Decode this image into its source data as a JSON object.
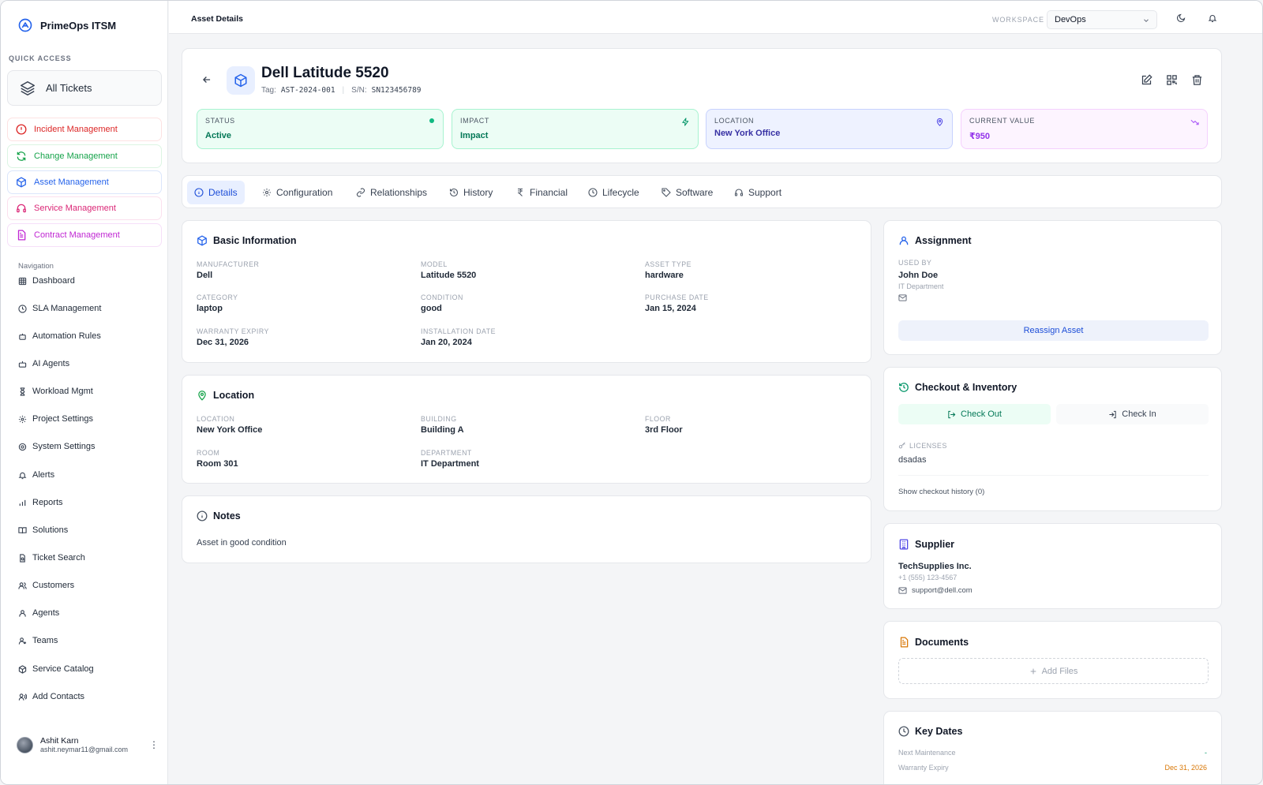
{
  "sidebar": {
    "brand": "PrimeOps ITSM",
    "quick_access_label": "QUICK ACCESS",
    "all_tickets": "All Tickets",
    "modules": [
      {
        "label": "Incident Management",
        "color": "#dc2626"
      },
      {
        "label": "Change Management",
        "color": "#16a34a"
      },
      {
        "label": "Asset Management",
        "color": "#2563eb"
      },
      {
        "label": "Service Management",
        "color": "#db2777"
      },
      {
        "label": "Contract Management",
        "color": "#c026d3"
      }
    ],
    "nav_label": "Navigation",
    "nav": [
      {
        "label": "Dashboard",
        "icon": "grid-icon"
      },
      {
        "label": "SLA Management",
        "icon": "clock-icon"
      },
      {
        "label": "Automation Rules",
        "icon": "bot-icon"
      },
      {
        "label": "AI Agents",
        "icon": "robot-icon"
      },
      {
        "label": "Workload Mgmt",
        "icon": "hourglass-icon"
      },
      {
        "label": "Project Settings",
        "icon": "gear-icon"
      },
      {
        "label": "System Settings",
        "icon": "cog-icon"
      },
      {
        "label": "Alerts",
        "icon": "bell-icon"
      },
      {
        "label": "Reports",
        "icon": "bar-chart-icon"
      },
      {
        "label": "Solutions",
        "icon": "book-icon"
      },
      {
        "label": "Ticket Search",
        "icon": "file-search-icon"
      },
      {
        "label": "Customers",
        "icon": "users-icon"
      },
      {
        "label": "Agents",
        "icon": "user-icon"
      },
      {
        "label": "Teams",
        "icon": "user-plus-icon"
      },
      {
        "label": "Service Catalog",
        "icon": "package-icon"
      },
      {
        "label": "Add Contacts",
        "icon": "contact-icon"
      }
    ],
    "user": {
      "name": "Ashit Karn",
      "email": "ashit.neymar11@gmail.com"
    }
  },
  "topbar": {
    "breadcrumb": "Asset Details",
    "workspace_label": "WORKSPACE",
    "workspace_value": "DevOps"
  },
  "asset": {
    "name": "Dell Latitude 5520",
    "tag_label": "Tag:",
    "tag": "AST-2024-001",
    "sn_label": "S/N:",
    "sn": "SN123456789"
  },
  "stats": [
    {
      "label": "STATUS",
      "value": "Active",
      "bg": "#ecfdf5",
      "border": "#a7f3d0",
      "color": "#047857"
    },
    {
      "label": "IMPACT",
      "value": "Impact",
      "bg": "#ecfdf5",
      "border": "#a7f3d0",
      "color": "#047857"
    },
    {
      "label": "LOCATION",
      "value": "New York Office",
      "bg": "#eef2ff",
      "border": "#c7d2fe",
      "color": "#3730a3"
    },
    {
      "label": "CURRENT VALUE",
      "value": "₹950",
      "bg": "#fdf4ff",
      "border": "#f5d0fe",
      "color": "#9333ea"
    }
  ],
  "tabs": [
    "Details",
    "Configuration",
    "Relationships",
    "History",
    "Financial",
    "Lifecycle",
    "Software",
    "Support"
  ],
  "basic_info": {
    "title": "Basic Information",
    "fields": [
      {
        "k": "MANUFACTURER",
        "v": "Dell"
      },
      {
        "k": "MODEL",
        "v": "Latitude 5520"
      },
      {
        "k": "ASSET TYPE",
        "v": "hardware"
      },
      {
        "k": "CATEGORY",
        "v": "laptop"
      },
      {
        "k": "CONDITION",
        "v": "good"
      },
      {
        "k": "PURCHASE DATE",
        "v": "Jan 15, 2024"
      },
      {
        "k": "WARRANTY EXPIRY",
        "v": "Dec 31, 2026"
      },
      {
        "k": "INSTALLATION DATE",
        "v": "Jan 20, 2024"
      }
    ]
  },
  "location": {
    "title": "Location",
    "fields": [
      {
        "k": "LOCATION",
        "v": "New York Office"
      },
      {
        "k": "BUILDING",
        "v": "Building A"
      },
      {
        "k": "FLOOR",
        "v": "3rd Floor"
      },
      {
        "k": "ROOM",
        "v": "Room 301"
      },
      {
        "k": "DEPARTMENT",
        "v": "IT Department"
      }
    ]
  },
  "notes": {
    "title": "Notes",
    "text": "Asset in good condition"
  },
  "assignment": {
    "title": "Assignment",
    "used_by_label": "USED BY",
    "name": "John Doe",
    "dept": "IT Department",
    "button": "Reassign Asset"
  },
  "checkout": {
    "title": "Checkout & Inventory",
    "check_out": "Check Out",
    "check_in": "Check In",
    "licenses_label": "LICENSES",
    "licenses_value": "dsadas",
    "history_link": "Show checkout history (0)"
  },
  "supplier": {
    "title": "Supplier",
    "name": "TechSupplies Inc.",
    "phone": "+1 (555) 123-4567",
    "email": "support@dell.com"
  },
  "documents": {
    "title": "Documents",
    "add_files": "Add Files"
  },
  "key_dates": {
    "title": "Key Dates",
    "rows": [
      {
        "k": "Next Maintenance",
        "v": "-"
      },
      {
        "k": "Warranty Expiry",
        "v": "Dec 31, 2026"
      }
    ]
  }
}
